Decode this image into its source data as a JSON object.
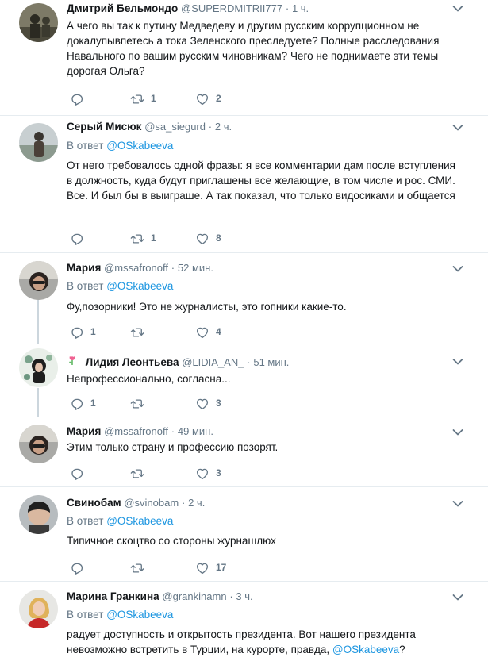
{
  "tweets": [
    {
      "name": "Дмитрий Бельмондо",
      "handle": "@SUPERDMITRII777",
      "time": "1 ч.",
      "reply_prefix": "",
      "reply_to": "",
      "text": "А чего вы так к путину Медведеву и другим русским коррупционном не докалупывпетесь а тока Зеленского преследуете? Полные расследования Навального по вашим русским чиновникам?  Чего не поднимаете эти темы дорогая Ольга?",
      "replies": "",
      "retweets": "1",
      "likes": "2"
    },
    {
      "name": "Серый Мисюк",
      "handle": "@sa_siegurd",
      "time": "2 ч.",
      "reply_prefix": "В ответ",
      "reply_to": "@OSkabeeva",
      "text": "От него требовалось одной фразы: я все комментарии дам после вступления в должность, куда будут приглашены все желающие, в том числе и рос. СМИ. Все. И был бы в выиграше. А так показал, что только видосиками и общается",
      "replies": "",
      "retweets": "1",
      "likes": "8"
    },
    {
      "name": "Мария",
      "handle": "@mssafronoff",
      "time": "52 мин.",
      "reply_prefix": "В ответ",
      "reply_to": "@OSkabeeva",
      "text": "Фу,позорники! Это не журналисты, это гопники какие-то.",
      "replies": "1",
      "retweets": "",
      "likes": "4"
    },
    {
      "name": "Лидия Леонтьева",
      "handle": "@LIDIA_AN_",
      "time": "51 мин.",
      "reply_prefix": "",
      "reply_to": "",
      "text": "Непрофессионально, согласна...",
      "replies": "1",
      "retweets": "",
      "likes": "3"
    },
    {
      "name": "Мария",
      "handle": "@mssafronoff",
      "time": "49 мин.",
      "reply_prefix": "",
      "reply_to": "",
      "text": "Этим только страну и профессию позорят.",
      "replies": "",
      "retweets": "",
      "likes": "3"
    },
    {
      "name": "Свинобам",
      "handle": "@svinobam",
      "time": "2 ч.",
      "reply_prefix": "В ответ",
      "reply_to": "@OSkabeeva",
      "text": "Типичное скоцтво со стороны журнашлюх",
      "replies": "",
      "retweets": "",
      "likes": "17"
    },
    {
      "name": "Марина Гранкина",
      "handle": "@grankinamn",
      "time": "3 ч.",
      "reply_prefix": "В ответ",
      "reply_to": "@OSkabeeva",
      "text": "радует доступность и открытость президента. Вот нашего президента невозможно встретить в Турции, на курорте, правда,",
      "text_mention": "@OSkabeeva",
      "text_tail": "?",
      "replies": "",
      "retweets": "",
      "likes": ""
    }
  ],
  "icons": {
    "reply": "reply-icon",
    "retweet": "retweet-icon",
    "like": "heart-icon",
    "more": "chevron-down-icon",
    "emoji": "flower-icon"
  },
  "colors": {
    "link": "#1b95e0",
    "secondary": "#657786",
    "divider": "#e6ecf0",
    "thread_line": "#ccd6dd"
  },
  "dot": "·"
}
